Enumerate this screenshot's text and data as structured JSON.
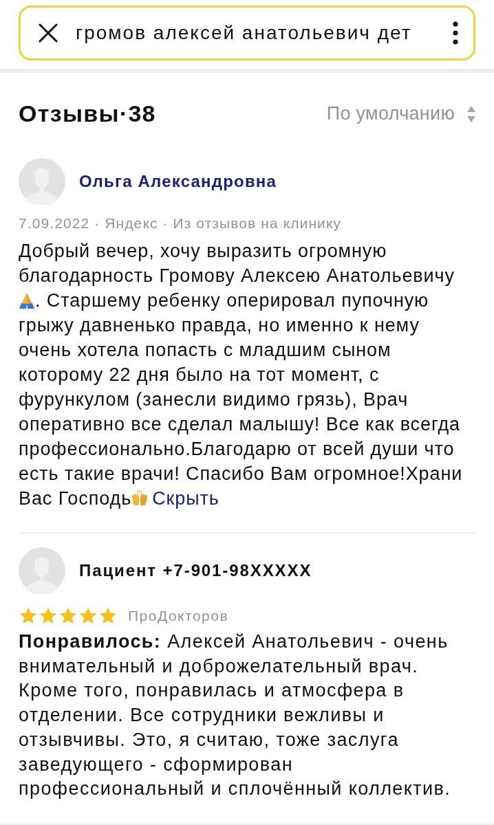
{
  "search": {
    "value": "громов алексей анатольевич дет"
  },
  "reviews_header": {
    "title": "Отзывы·38",
    "sort": "По умолчанию"
  },
  "reviews": [
    {
      "author": "Ольга Александровна",
      "name_link": true,
      "meta": "7.09.2022 · Яндекс · Из отзывов на клинику",
      "body": [
        {
          "kind": "text",
          "text": "Добрый вечер, хочу выразить огромную благодарность Громову Алексею Анатольевичу "
        },
        {
          "kind": "pray"
        },
        {
          "kind": "text",
          "text": ". Старшему ребенку оперировал пупочную грыжу давненько правда, но именно к нему очень хотела попасть с младшим сыном которому 22 дня было на тот момент, с фурункулом (занесли видимо грязь), Врач оперативно все сделал малышу! Все как всегда профессионально.Благодарю от всей души что есть такие врачи! Спасибо Вам огромное!Храни Вас Господь"
        },
        {
          "kind": "cheer"
        },
        {
          "kind": "link",
          "text": "Скрыть"
        }
      ]
    },
    {
      "author": "Пациент +7-901-98XXXXX",
      "name_link": false,
      "stars": 5,
      "source": "ПроДокторов",
      "body": [
        {
          "kind": "text",
          "text": "**Понравилось:** Алексей Анатольевич - очень внимательный и доброжелательный врач. Кроме того, понравилась и атмосфера в отделении. Все сотрудники вежливы и отзывчивы. Это, я считаю, тоже заслуга заведующего - сформирован профессиональный и сплочённый коллектив."
        }
      ]
    }
  ]
}
